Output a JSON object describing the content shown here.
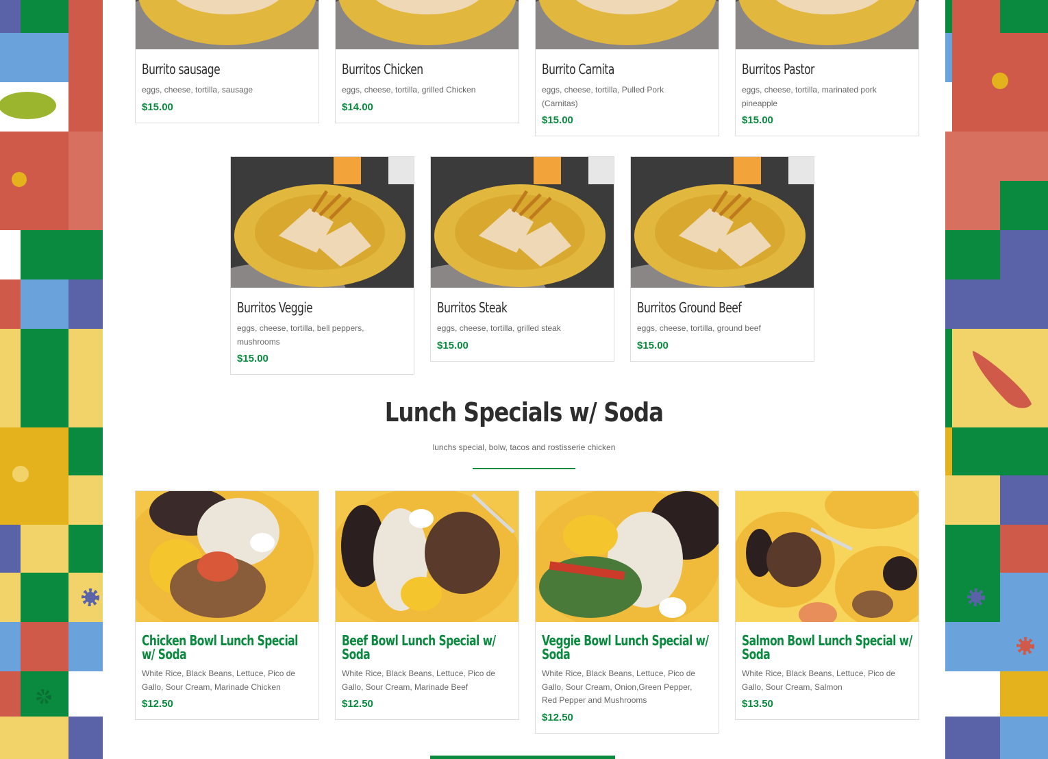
{
  "colors": {
    "accent": "#0a8a3e",
    "card_border": "#dcdcdc",
    "title_text": "#2d2d2d",
    "desc_text": "#666666"
  },
  "burritos_row1": [
    {
      "name": "Burrito sausage",
      "desc": "eggs, cheese, tortilla, sausage",
      "price": "$15.00"
    },
    {
      "name": "Burritos Chicken",
      "desc": "eggs, cheese, tortilla, grilled Chicken",
      "price": "$14.00"
    },
    {
      "name": "Burrito Carnita",
      "desc": "eggs, cheese, tortilla, Pulled Pork (Carnitas)",
      "price": "$15.00"
    },
    {
      "name": "Burritos Pastor",
      "desc": "eggs, cheese, tortilla, marinated pork pineapple",
      "price": "$15.00"
    }
  ],
  "burritos_row2": [
    {
      "name": "Burritos Veggie",
      "desc": "eggs, cheese, tortilla, bell peppers, mushrooms",
      "price": "$15.00"
    },
    {
      "name": "Burritos Steak",
      "desc": "eggs, cheese, tortilla, grilled steak",
      "price": "$15.00"
    },
    {
      "name": "Burritos Ground Beef",
      "desc": "eggs, cheese, tortilla, ground beef",
      "price": "$15.00"
    }
  ],
  "lunch_section": {
    "title": "Lunch Specials w/ Soda",
    "subtitle": "lunchs special, bolw, tacos and rostisserie chicken"
  },
  "lunch_items": [
    {
      "name": "Chicken Bowl Lunch Special w/ Soda",
      "desc": "White Rice, Black Beans, Lettuce, Pico de Gallo, Sour Cream, Marinade Chicken",
      "price": "$12.50"
    },
    {
      "name": "Beef Bowl Lunch Special w/ Soda",
      "desc": "White Rice, Black Beans, Lettuce, Pico de Gallo, Sour Cream, Marinade Beef",
      "price": "$12.50"
    },
    {
      "name": "Veggie Bowl Lunch Special w/ Soda",
      "desc": "White Rice, Black Beans, Lettuce, Pico de Gallo, Sour Cream, Onion,Green Pepper, Red Pepper and Mushrooms",
      "price": "$12.50"
    },
    {
      "name": "Salmon Bowl Lunch Special w/ Soda",
      "desc": "White Rice, Black Beans, Lettuce, Pico de Gallo, Sour Cream, Salmon",
      "price": "$13.50"
    }
  ]
}
